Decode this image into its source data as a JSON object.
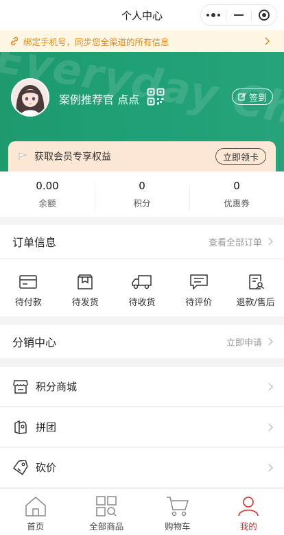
{
  "topbar": {
    "title": "个人中心"
  },
  "notice": {
    "text": "绑定手机号，同步您全渠道的所有信息"
  },
  "hero": {
    "watermark": "Everyday Chain",
    "username": "案例推荐官 点点",
    "signin_label": "签到"
  },
  "vip": {
    "text": "获取会员专享权益",
    "button": "立即领卡"
  },
  "stats": [
    {
      "value": "0.00",
      "label": "余额"
    },
    {
      "value": "0",
      "label": "积分"
    },
    {
      "value": "0",
      "label": "优惠券"
    }
  ],
  "orders": {
    "title": "订单信息",
    "more": "查看全部订单",
    "items": [
      {
        "label": "待付款",
        "icon": "card-icon"
      },
      {
        "label": "待发货",
        "icon": "package-icon"
      },
      {
        "label": "待收货",
        "icon": "truck-icon"
      },
      {
        "label": "待评价",
        "icon": "comment-icon"
      },
      {
        "label": "退款/售后",
        "icon": "refund-icon"
      }
    ]
  },
  "distribution": {
    "title": "分销中心",
    "more": "立即申请"
  },
  "menu": [
    {
      "label": "积分商城",
      "icon": "store-icon"
    },
    {
      "label": "拼团",
      "icon": "group-icon"
    },
    {
      "label": "砍价",
      "icon": "tag-icon"
    }
  ],
  "tabbar": [
    {
      "label": "首页",
      "icon": "home-icon"
    },
    {
      "label": "全部商品",
      "icon": "grid-icon"
    },
    {
      "label": "购物车",
      "icon": "cart-icon"
    },
    {
      "label": "我的",
      "icon": "user-icon"
    }
  ],
  "colors": {
    "accent": "#1fa076",
    "active_tab": "#e0262d",
    "notice": "#e08a1e"
  }
}
